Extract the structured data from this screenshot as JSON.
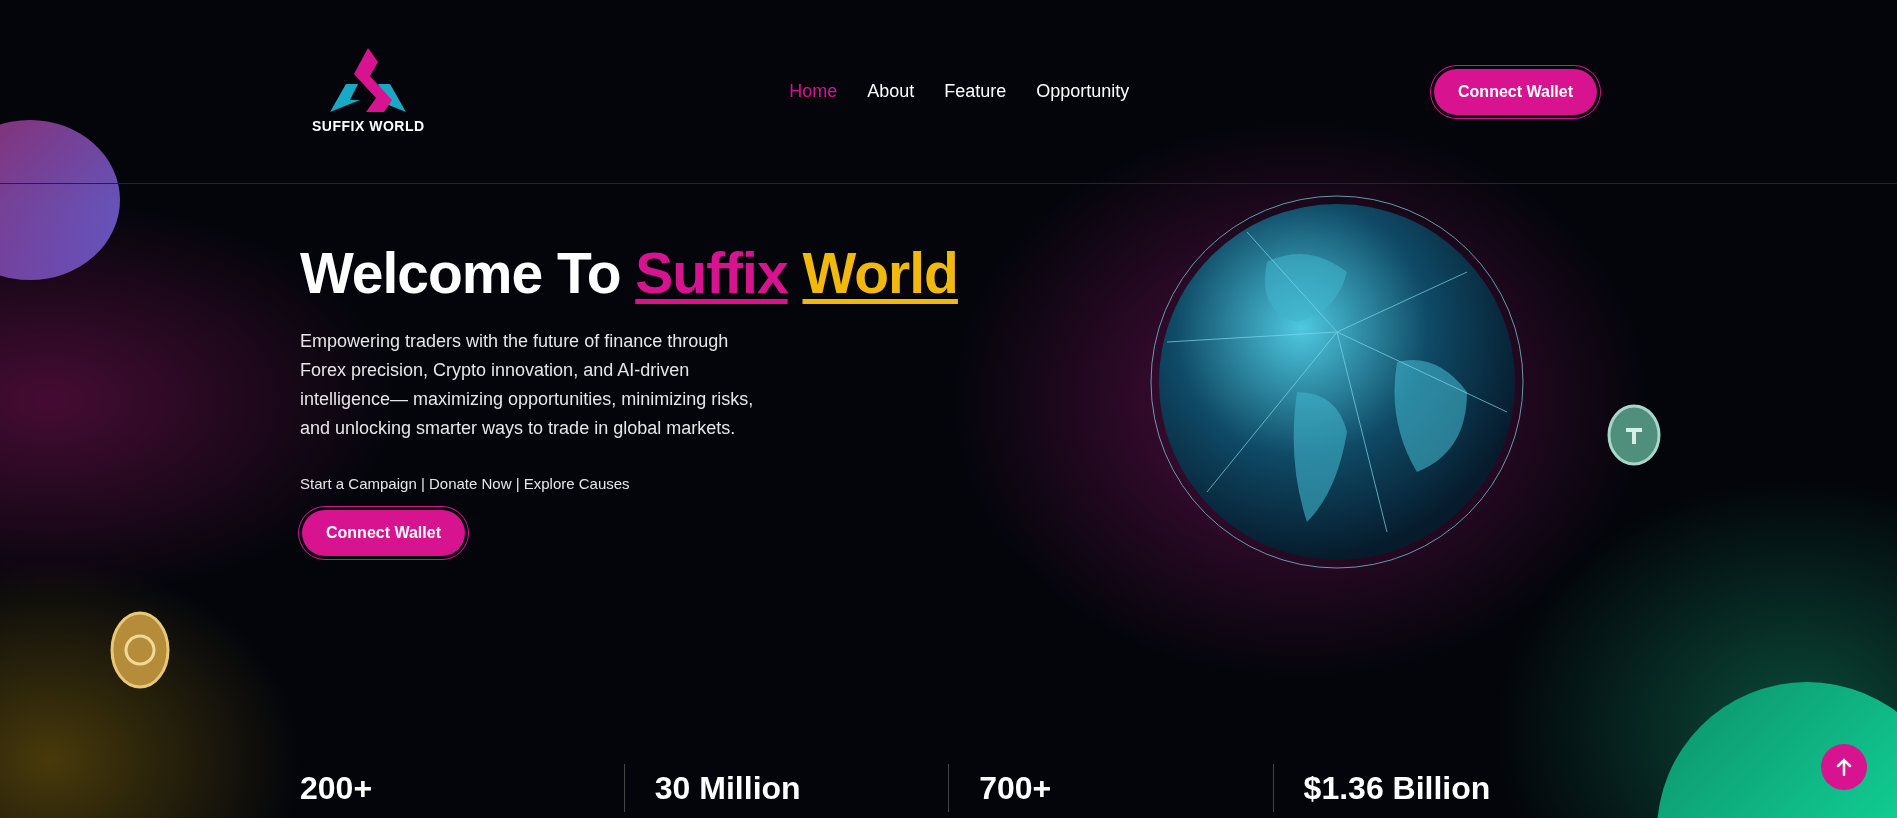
{
  "header": {
    "logo_text": "SUFFIX WORLD",
    "nav": [
      {
        "label": "Home",
        "selected": true
      },
      {
        "label": "About",
        "selected": false
      },
      {
        "label": "Feature",
        "selected": false
      },
      {
        "label": "Opportunity",
        "selected": false
      }
    ],
    "button": "Connect Wallet"
  },
  "hero": {
    "title": "Welcome To",
    "title_highlights": [
      {
        "text": "Suffix",
        "color": "#d8138f"
      },
      {
        "text": "World",
        "color": "#f1b80e"
      }
    ],
    "description": "Empowering traders with the future of finance through Forex precision, Crypto innovation, and AI-driven intelligence— maximizing opportunities, minimizing risks, and unlocking smarter ways to trade in global markets.",
    "links": "Start a Campaign | Donate Now | Explore Causes",
    "button": "Connect Wallet"
  },
  "stats": [
    {
      "value": "200+"
    },
    {
      "value": "30 Million"
    },
    {
      "value": "700+"
    },
    {
      "value": "$1.36 Billion"
    }
  ]
}
